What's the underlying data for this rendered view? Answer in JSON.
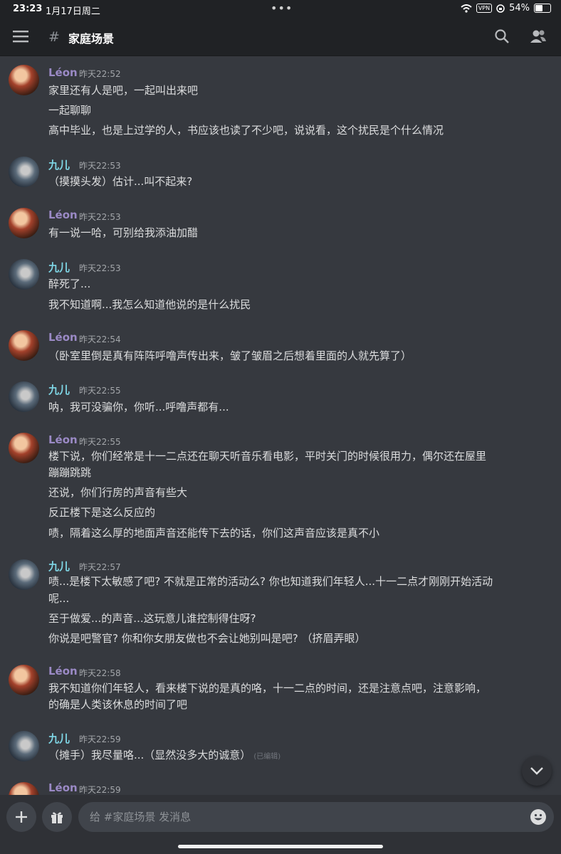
{
  "status_bar": {
    "time": "23:23",
    "date": "1月17日周二",
    "vpn": "VPN",
    "battery": "54%"
  },
  "header": {
    "channel_name": "家庭场景"
  },
  "messages": [
    {
      "user": "Léon",
      "time": "昨天22:52",
      "lines": [
        "家里还有人是吧，一起叫出来吧",
        "一起聊聊",
        "高中毕业，也是上过学的人，书应该也读了不少吧，说说看，这个扰民是个什么情况"
      ]
    },
    {
      "user": "九儿",
      "time": "昨天22:53",
      "lines": [
        "（摸摸头发）估计...叫不起来?"
      ]
    },
    {
      "user": "Léon",
      "time": "昨天22:53",
      "lines": [
        "有一说一哈，可别给我添油加醋"
      ]
    },
    {
      "user": "九儿",
      "time": "昨天22:53",
      "lines": [
        "醉死了...",
        "我不知道啊...我怎么知道他说的是什么扰民"
      ]
    },
    {
      "user": "Léon",
      "time": "昨天22:54",
      "lines": [
        "（卧室里倒是真有阵阵呼噜声传出来，皱了皱眉之后想着里面的人就先算了）"
      ]
    },
    {
      "user": "九儿",
      "time": "昨天22:55",
      "lines": [
        "呐，我可没骗你，你听...呼噜声都有..."
      ]
    },
    {
      "user": "Léon",
      "time": "昨天22:55",
      "lines": [
        "楼下说，你们经常是十一二点还在聊天听音乐看电影，平时关门的时候很用力，偶尔还在屋里",
        "蹦蹦跳跳",
        "还说，你们行房的声音有些大",
        "反正楼下是这么反应的",
        "啧，隔着这么厚的地面声音还能传下去的话，你们这声音应该是真不小"
      ]
    },
    {
      "user": "九儿",
      "time": "昨天22:57",
      "lines": [
        "啧...是楼下太敏感了吧? 不就是正常的活动么? 你也知道我们年轻人...十一二点才刚刚开始活动",
        "呢...",
        "至于做爱...的声音...这玩意儿谁控制得住呀?",
        "你说是吧警官? 你和你女朋友做也不会让她别叫是吧? （挤眉弄眼）"
      ]
    },
    {
      "user": "Léon",
      "time": "昨天22:58",
      "lines": [
        "我不知道你们年轻人，看来楼下说的是真的咯，十一二点的时间，还是注意点吧，注意影响，",
        "的确是人类该休息的时间了吧"
      ]
    },
    {
      "user": "九儿",
      "time": "昨天22:59",
      "lines": [
        "（摊手）我尽量咯...（显然没多大的诚意）"
      ],
      "edited": "(已编辑)"
    },
    {
      "user": "Léon",
      "time": "昨天22:59",
      "lines": []
    }
  ],
  "composer": {
    "placeholder": "给 #家庭场景 发消息"
  },
  "colors": {
    "background": "#36393f",
    "header": "#202225",
    "leon_name": "#9b8ac6",
    "jiu_name": "#7fd7e6"
  }
}
